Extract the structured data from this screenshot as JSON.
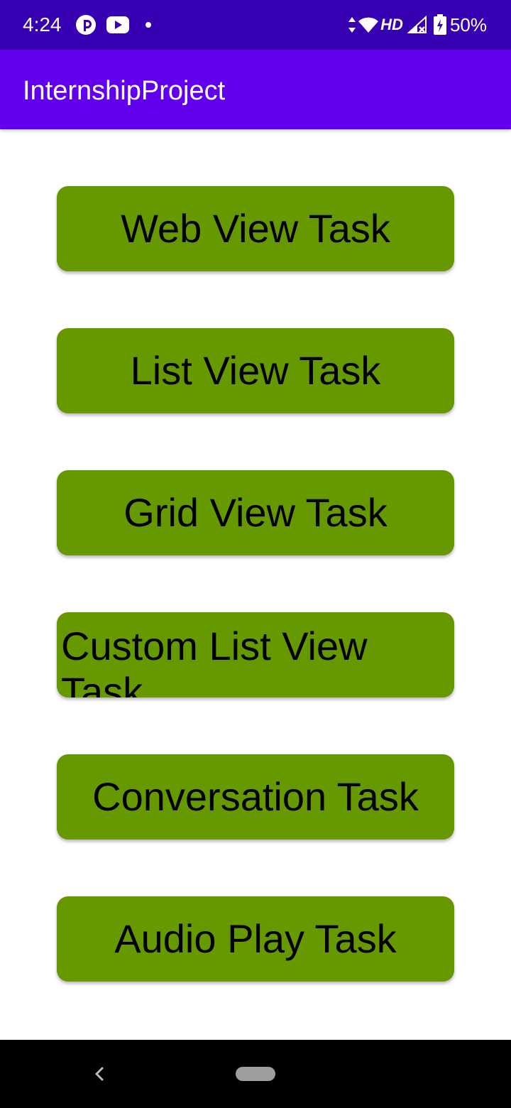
{
  "status_bar": {
    "time": "4:24",
    "network_label": "HD",
    "battery": "50%",
    "icons": [
      "pocketcasts-icon",
      "youtube-icon",
      "notification-dot-icon",
      "data-arrows-icon",
      "wifi-icon",
      "signal-icon",
      "battery-icon"
    ]
  },
  "app_bar": {
    "title": "InternshipProject"
  },
  "buttons": {
    "web_view": "Web View Task",
    "list_view": "List View Task",
    "grid_view": "Grid View Task",
    "custom_list_view": "Custom List View Task",
    "conversation": "Conversation Task",
    "audio_play": "Audio Play Task"
  },
  "colors": {
    "status_bar": "#3700b3",
    "app_bar": "#6200ee",
    "button": "#669900",
    "nav_bar": "#000000"
  }
}
